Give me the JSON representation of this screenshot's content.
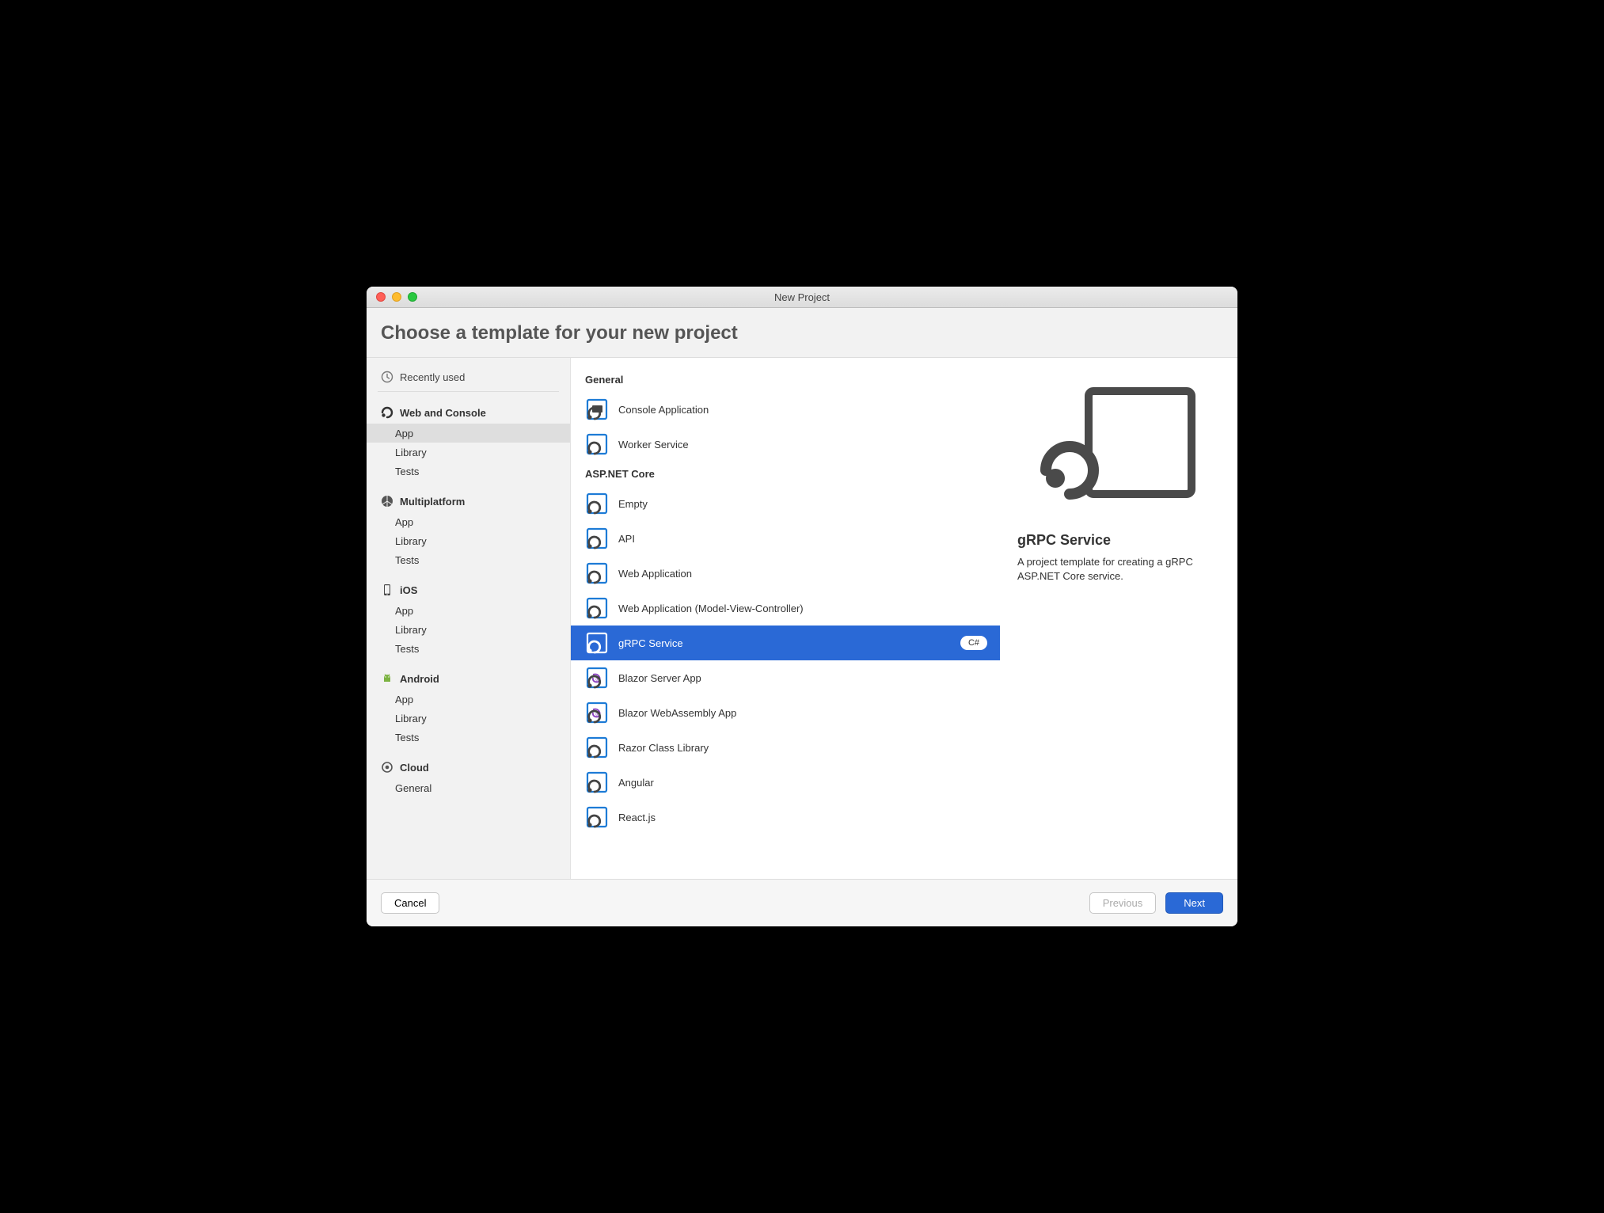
{
  "window": {
    "title": "New Project"
  },
  "header": {
    "title": "Choose a template for your new project"
  },
  "sidebar": {
    "recent_label": "Recently used",
    "categories": [
      {
        "label": "Web and Console",
        "icon": "dotnet",
        "items": [
          "App",
          "Library",
          "Tests"
        ],
        "selected": 0,
        "is_active_cat": true
      },
      {
        "label": "Multiplatform",
        "icon": "multiplatform",
        "items": [
          "App",
          "Library",
          "Tests"
        ]
      },
      {
        "label": "iOS",
        "icon": "ios",
        "items": [
          "App",
          "Library",
          "Tests"
        ]
      },
      {
        "label": "Android",
        "icon": "android",
        "items": [
          "App",
          "Library",
          "Tests"
        ]
      },
      {
        "label": "Cloud",
        "icon": "cloud",
        "items": [
          "General"
        ]
      }
    ]
  },
  "main": {
    "sections": [
      {
        "title": "General",
        "templates": [
          {
            "label": "Console Application",
            "icon": "console"
          },
          {
            "label": "Worker Service",
            "icon": "worker"
          }
        ]
      },
      {
        "title": "ASP.NET Core",
        "templates": [
          {
            "label": "Empty",
            "icon": "net"
          },
          {
            "label": "API",
            "icon": "net"
          },
          {
            "label": "Web Application",
            "icon": "net"
          },
          {
            "label": "Web Application (Model-View-Controller)",
            "icon": "net"
          },
          {
            "label": "gRPC Service",
            "icon": "net-white",
            "selected": true,
            "badge": "C#"
          },
          {
            "label": "Blazor Server App",
            "icon": "blazor"
          },
          {
            "label": "Blazor WebAssembly App",
            "icon": "blazor"
          },
          {
            "label": "Razor Class Library",
            "icon": "net"
          },
          {
            "label": "Angular",
            "icon": "net"
          },
          {
            "label": "React.js",
            "icon": "net"
          }
        ]
      }
    ]
  },
  "detail": {
    "title": "gRPC Service",
    "description": "A project template for creating a gRPC ASP.NET Core service."
  },
  "footer": {
    "cancel": "Cancel",
    "previous": "Previous",
    "next": "Next"
  }
}
